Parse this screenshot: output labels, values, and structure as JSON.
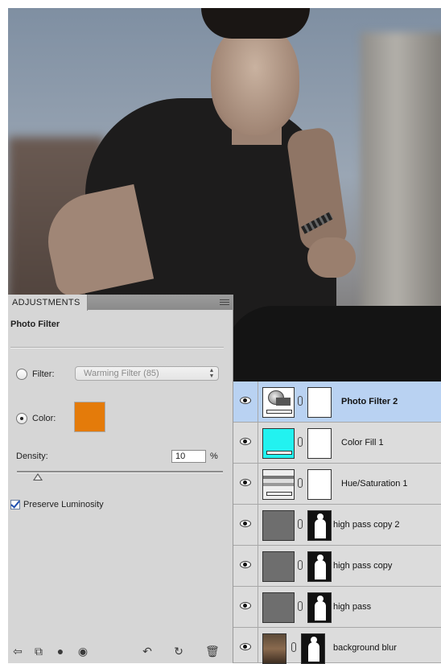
{
  "adjustments": {
    "tab_label": "ADJUSTMENTS",
    "panel_title": "Photo Filter",
    "filter_label": "Filter:",
    "filter_value": "Warming Filter (85)",
    "color_label": "Color:",
    "color_value": "#e47b0a",
    "selected_mode": "color",
    "density_label": "Density:",
    "density_value": "10",
    "density_unit": "%",
    "density_fraction": 0.1,
    "preserve_luminosity_label": "Preserve Luminosity",
    "preserve_luminosity_checked": true,
    "bottom_icons": [
      "back-arrow-icon",
      "view-toggle-icon",
      "clip-to-layer-icon",
      "visibility-eye-icon",
      "previous-state-icon",
      "reset-icon",
      "trash-icon"
    ]
  },
  "layers": [
    {
      "name": "Photo Filter 2",
      "selected": true,
      "thumb": "photo-filter",
      "mask": "white"
    },
    {
      "name": "Color Fill 1",
      "selected": false,
      "thumb": "color-fill",
      "mask": "white"
    },
    {
      "name": "Hue/Saturation 1",
      "selected": false,
      "thumb": "hue-saturation",
      "mask": "white"
    },
    {
      "name": "high pass copy 2",
      "selected": false,
      "thumb": "gray",
      "mask": "silhouette"
    },
    {
      "name": "high pass copy",
      "selected": false,
      "thumb": "gray",
      "mask": "silhouette"
    },
    {
      "name": "high pass",
      "selected": false,
      "thumb": "gray",
      "mask": "silhouette"
    },
    {
      "name": "background blur",
      "selected": false,
      "thumb": "photo",
      "mask": "silhouette"
    }
  ],
  "colors": {
    "selected_layer": "#b9d2f2",
    "color_fill": "#22f2f0",
    "filter_color": "#e47b0a"
  }
}
